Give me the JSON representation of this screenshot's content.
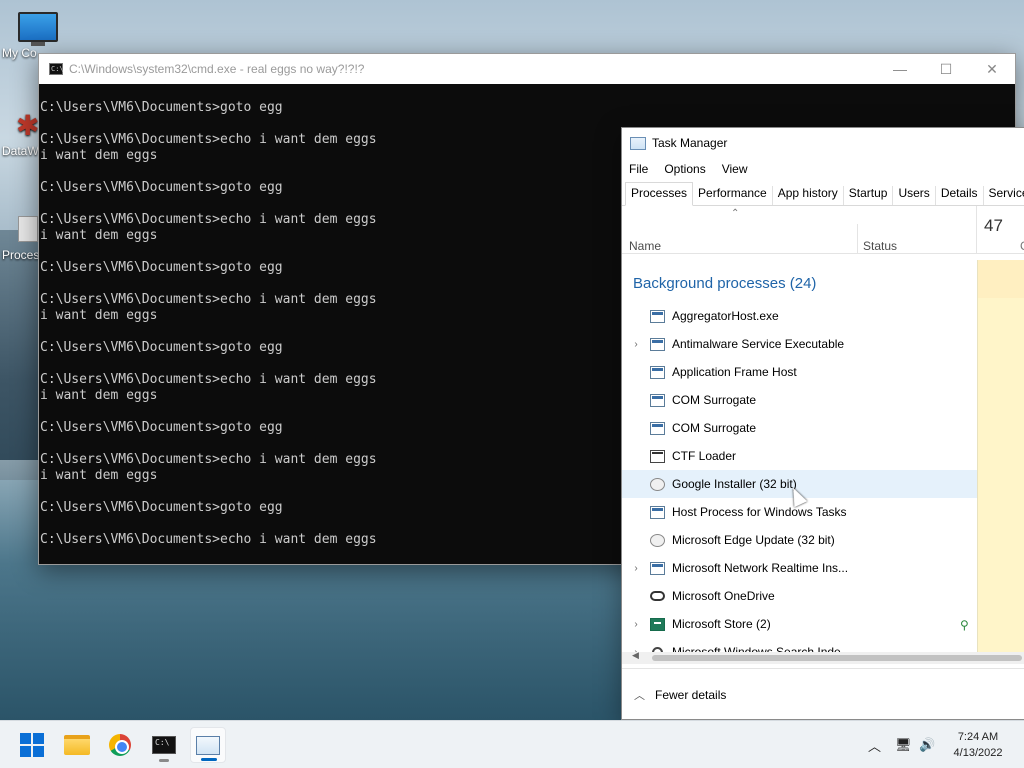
{
  "desktop": {
    "icons": [
      {
        "label": "My Co",
        "icon": "this-pc-icon"
      },
      {
        "label": "DataW",
        "icon": "shortcut-icon"
      },
      {
        "label": "Proces",
        "icon": "process-icon"
      }
    ]
  },
  "cmd": {
    "title": "C:\\Windows\\system32\\cmd.exe - real  eggs no way?!?!?",
    "lines": [
      "C:\\Users\\VM6\\Documents>goto egg",
      "",
      "C:\\Users\\VM6\\Documents>echo i want dem eggs",
      "i want dem eggs",
      "",
      "C:\\Users\\VM6\\Documents>goto egg",
      "",
      "C:\\Users\\VM6\\Documents>echo i want dem eggs",
      "i want dem eggs",
      "",
      "C:\\Users\\VM6\\Documents>goto egg",
      "",
      "C:\\Users\\VM6\\Documents>echo i want dem eggs",
      "i want dem eggs",
      "",
      "C:\\Users\\VM6\\Documents>goto egg",
      "",
      "C:\\Users\\VM6\\Documents>echo i want dem eggs",
      "i want dem eggs",
      "",
      "C:\\Users\\VM6\\Documents>goto egg",
      "",
      "C:\\Users\\VM6\\Documents>echo i want dem eggs",
      "i want dem eggs",
      "",
      "C:\\Users\\VM6\\Documents>goto egg",
      "",
      "C:\\Users\\VM6\\Documents>echo i want dem eggs"
    ]
  },
  "taskmanager": {
    "title": "Task Manager",
    "menu": [
      "File",
      "Options",
      "View"
    ],
    "tabs": [
      "Processes",
      "Performance",
      "App history",
      "Startup",
      "Users",
      "Details",
      "Services"
    ],
    "active_tab": "Processes",
    "columns": {
      "name": "Name",
      "status": "Status",
      "cpu_value": "47",
      "cpu_label": "C"
    },
    "group_label": "Background processes (24)",
    "rows": [
      {
        "name": "AggregatorHost.exe",
        "expandable": false,
        "icon": "window-icon"
      },
      {
        "name": "Antimalware Service Executable",
        "expandable": true,
        "icon": "window-icon"
      },
      {
        "name": "Application Frame Host",
        "expandable": false,
        "icon": "window-icon"
      },
      {
        "name": "COM Surrogate",
        "expandable": false,
        "icon": "window-icon"
      },
      {
        "name": "COM Surrogate",
        "expandable": false,
        "icon": "window-icon"
      },
      {
        "name": "CTF Loader",
        "expandable": false,
        "icon": "pen-icon"
      },
      {
        "name": "Google Installer (32 bit)",
        "expandable": false,
        "icon": "gear-icon",
        "highlighted": true
      },
      {
        "name": "Host Process for Windows Tasks",
        "expandable": false,
        "icon": "window-icon"
      },
      {
        "name": "Microsoft Edge Update (32 bit)",
        "expandable": false,
        "icon": "gear-icon"
      },
      {
        "name": "Microsoft Network Realtime Ins...",
        "expandable": true,
        "icon": "window-icon"
      },
      {
        "name": "Microsoft OneDrive",
        "expandable": false,
        "icon": "cloud-icon"
      },
      {
        "name": "Microsoft Store (2)",
        "expandable": true,
        "icon": "store-icon",
        "suspended_leaf": true
      },
      {
        "name": "Microsoft Windows Search Inde...",
        "expandable": true,
        "icon": "search-icon"
      }
    ],
    "footer": "Fewer details"
  },
  "taskbar": {
    "apps": [
      "start-icon",
      "file-explorer-icon",
      "chrome-icon",
      "cmd-icon",
      "task-manager-icon"
    ],
    "time": "7:24 AM",
    "date": "4/13/2022"
  },
  "colors": {
    "accent": "#0067c0",
    "group_header": "#1f64a8",
    "cpu_column": "#fff5c9",
    "console_bg": "#0c0c0c"
  }
}
